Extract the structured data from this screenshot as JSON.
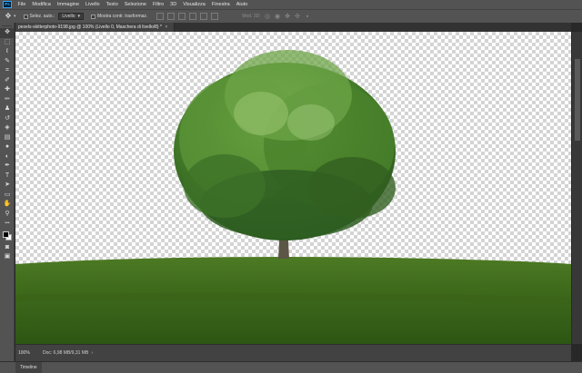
{
  "app": {
    "logo": "Ps"
  },
  "menu": [
    "File",
    "Modifica",
    "Immagine",
    "Livello",
    "Testo",
    "Selezione",
    "Filtro",
    "3D",
    "Visualizza",
    "Finestra",
    "Aiuto"
  ],
  "options": {
    "move_icon": "move-icon",
    "auto_select_label": "Selez. auto.:",
    "auto_select_value": "Livello",
    "show_transform_label": "Mostra contr. trasformaz.",
    "mode3d_label": "Mod. 3D:"
  },
  "document": {
    "tab_title": "pexels-skitterphoto-9198.jpg @ 100% (Livello 0, Maschera di livello/8) *",
    "close_glyph": "×"
  },
  "tools": [
    {
      "name": "move-tool",
      "glyph": "✥"
    },
    {
      "name": "marquee-tool",
      "glyph": "⬚"
    },
    {
      "name": "lasso-tool",
      "glyph": "ℓ"
    },
    {
      "name": "quick-select-tool",
      "glyph": "✎"
    },
    {
      "name": "crop-tool",
      "glyph": "⌗"
    },
    {
      "name": "eyedropper-tool",
      "glyph": "✐"
    },
    {
      "name": "healing-tool",
      "glyph": "✚"
    },
    {
      "name": "brush-tool",
      "glyph": "✏"
    },
    {
      "name": "stamp-tool",
      "glyph": "♟"
    },
    {
      "name": "history-brush-tool",
      "glyph": "↺"
    },
    {
      "name": "eraser-tool",
      "glyph": "◈"
    },
    {
      "name": "gradient-tool",
      "glyph": "▤"
    },
    {
      "name": "blur-tool",
      "glyph": "●"
    },
    {
      "name": "dodge-tool",
      "glyph": "◐"
    },
    {
      "name": "pen-tool",
      "glyph": "✒"
    },
    {
      "name": "type-tool",
      "glyph": "T"
    },
    {
      "name": "path-select-tool",
      "glyph": "➤"
    },
    {
      "name": "rectangle-tool",
      "glyph": "▭"
    },
    {
      "name": "hand-tool",
      "glyph": "✋"
    },
    {
      "name": "zoom-tool",
      "glyph": "⚲"
    },
    {
      "name": "more-tools",
      "glyph": "•••"
    }
  ],
  "tools_bottom": [
    {
      "name": "quick-mask-tool",
      "glyph": "◙"
    },
    {
      "name": "screen-mode-tool",
      "glyph": "▣"
    }
  ],
  "status": {
    "zoom": "100%",
    "doc_info": "Doc: 6,98 MB/9,31 MB",
    "caret": "›"
  },
  "panels": {
    "timeline_tab": "Timeline"
  },
  "colors": {
    "foreground": "#000000",
    "background": "#ffffff",
    "accent": "#31a8ff"
  }
}
